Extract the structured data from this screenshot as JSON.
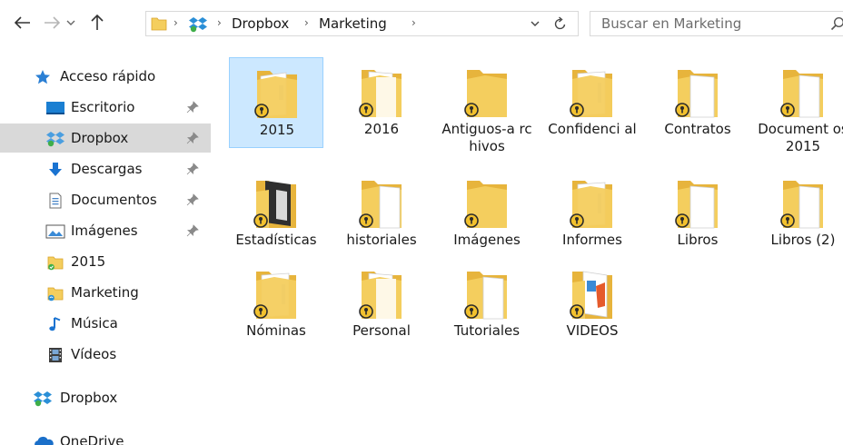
{
  "window": {
    "breadcrumb": [
      "Dropbox",
      "Marketing"
    ]
  },
  "search": {
    "placeholder": "Buscar en Marketing"
  },
  "sidebar": {
    "quick_access": "Acceso rápido",
    "items": [
      {
        "label": "Escritorio",
        "pinned": true
      },
      {
        "label": "Dropbox",
        "pinned": true,
        "selected": true
      },
      {
        "label": "Descargas",
        "pinned": true
      },
      {
        "label": "Documentos",
        "pinned": true
      },
      {
        "label": "Imágenes",
        "pinned": true
      },
      {
        "label": "2015"
      },
      {
        "label": "Marketing"
      },
      {
        "label": "Música"
      },
      {
        "label": "Vídeos"
      }
    ],
    "dropbox": "Dropbox",
    "onedrive": "OneDrive"
  },
  "folders": [
    {
      "label": "2015",
      "selected": true
    },
    {
      "label": "2016"
    },
    {
      "label": "Antiguos-a rchivos"
    },
    {
      "label": "Confidenci al"
    },
    {
      "label": "Contratos"
    },
    {
      "label": "Document os2015"
    },
    {
      "label": "Estadísticas"
    },
    {
      "label": "historiales"
    },
    {
      "label": "Imágenes"
    },
    {
      "label": "Informes"
    },
    {
      "label": "Libros"
    },
    {
      "label": "Libros (2)"
    },
    {
      "label": "Nóminas"
    },
    {
      "label": "Personal"
    },
    {
      "label": "Tutoriales"
    },
    {
      "label": "VIDEOS"
    }
  ],
  "colors": {
    "folder": "#f4ce5e",
    "folder_dark": "#e7b43c",
    "badge": "#f2c12e",
    "selection": "#cce8ff",
    "sidebar_selected": "#d9d9d9"
  }
}
